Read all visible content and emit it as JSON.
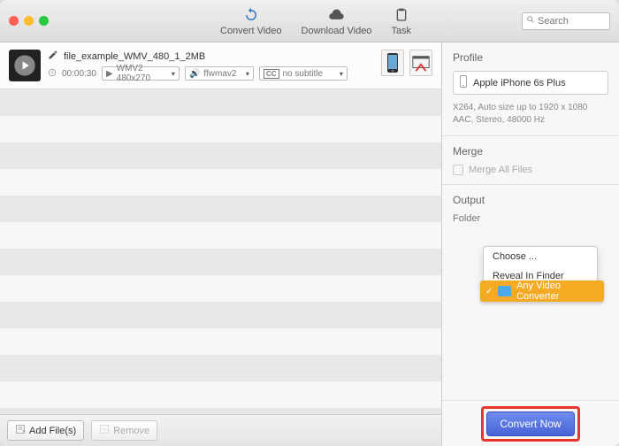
{
  "topnav": {
    "convert": "Convert Video",
    "download": "Download Video",
    "task": "Task"
  },
  "search": {
    "placeholder": "Search"
  },
  "file": {
    "name": "file_example_WMV_480_1_2MB",
    "duration": "00:00:30",
    "format": "WMV2 480x270",
    "audio": "ffwmav2",
    "subtitle": "no subtitle",
    "subtitle_prefix": "CC"
  },
  "footer": {
    "add": "Add File(s)",
    "remove": "Remove"
  },
  "sidebar": {
    "profile": {
      "heading": "Profile",
      "device": "Apple iPhone 6s Plus",
      "video_meta": "X264, Auto size up to 1920 x 1080",
      "audio_meta": "AAC, Stereo, 48000 Hz"
    },
    "merge": {
      "heading": "Merge",
      "label": "Merge All Files"
    },
    "output": {
      "heading": "Output",
      "label": "Folder"
    },
    "menu": {
      "choose": "Choose ...",
      "reveal": "Reveal In Finder",
      "selected": "Any Video Converter"
    },
    "convert": "Convert Now"
  }
}
